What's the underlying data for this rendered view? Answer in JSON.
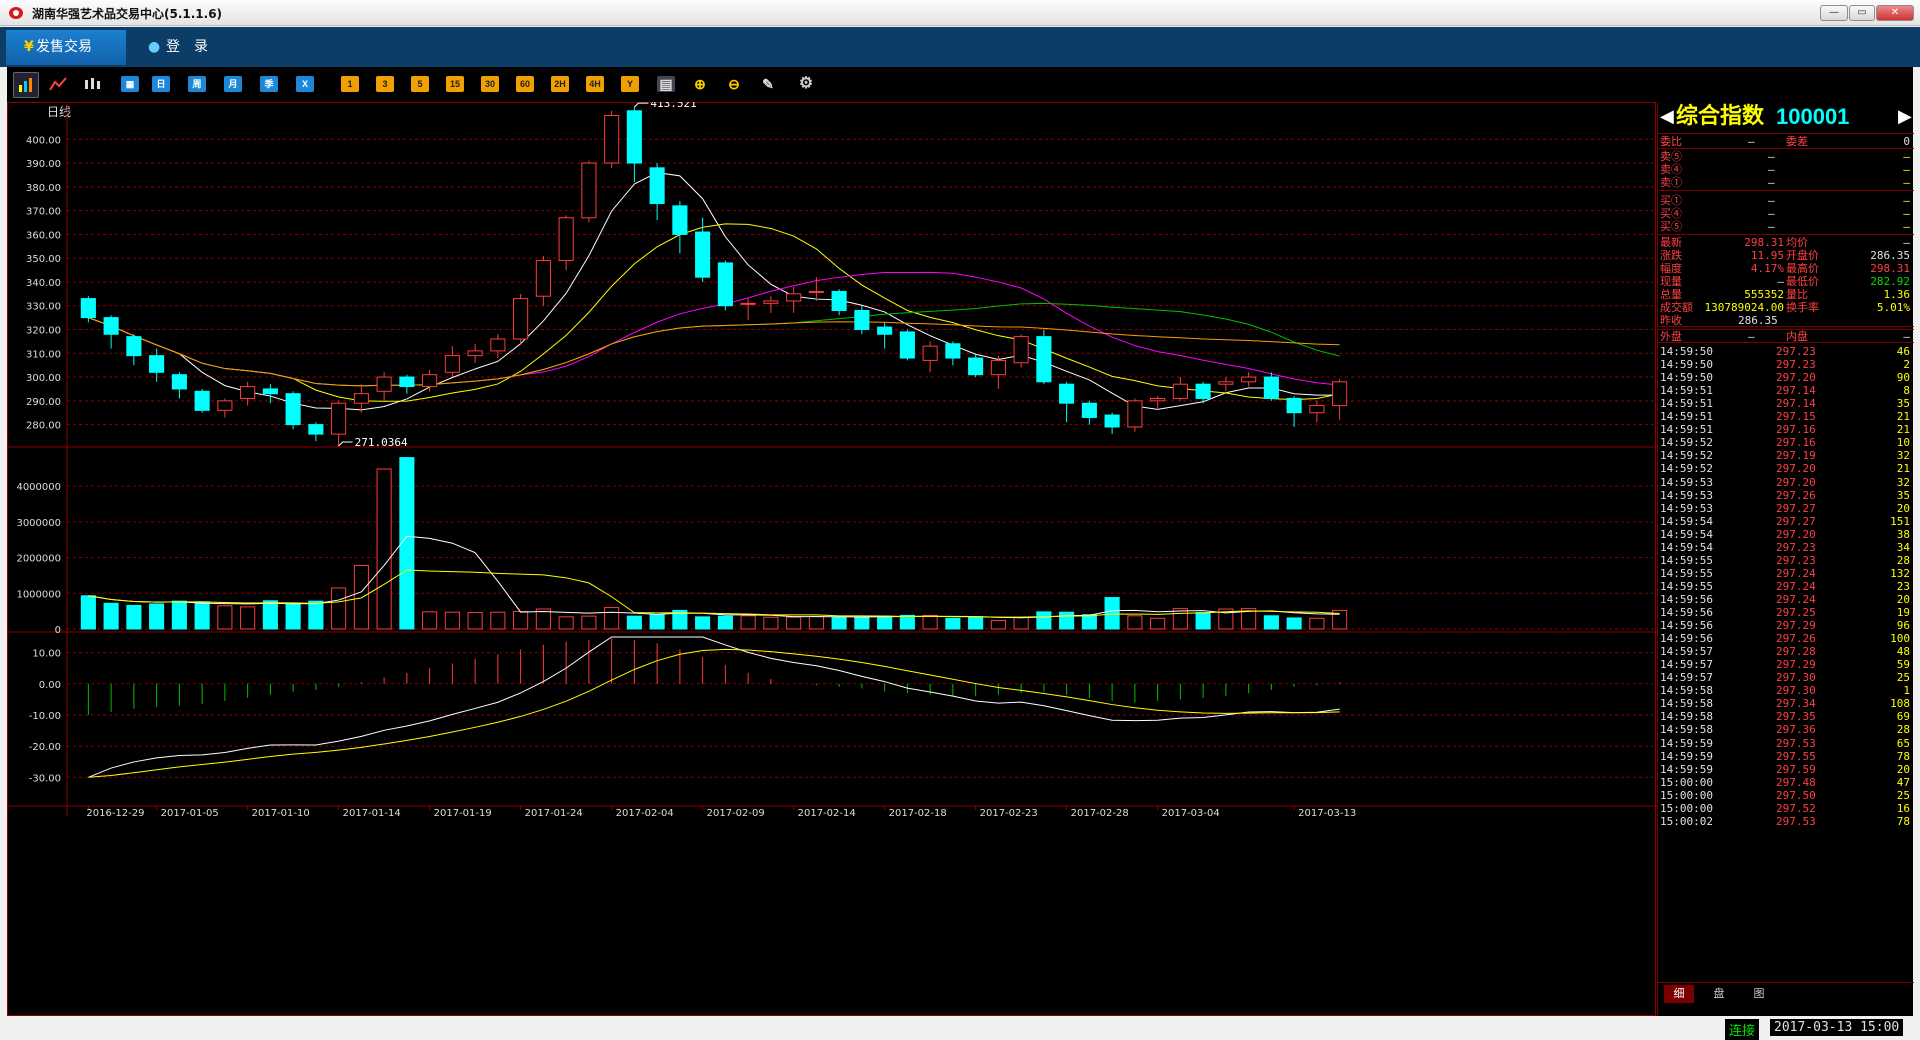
{
  "window": {
    "title": "湖南华强艺术品交易中心(5.1.1.6)",
    "minimize": "—",
    "restore": "▭",
    "close": "✕"
  },
  "menu": {
    "tabs": [
      {
        "label": "发售交易",
        "icon": "yen-icon"
      },
      {
        "label": "登　录",
        "icon": "user-icon"
      }
    ]
  },
  "toolbar": {
    "period_buttons": [
      "日",
      "周",
      "月",
      "季",
      "X"
    ],
    "minute_buttons": [
      "1",
      "3",
      "5",
      "15",
      "30",
      "60",
      "2H",
      "4H",
      "Y"
    ]
  },
  "chart": {
    "period_label": "日线",
    "colors": {
      "up": "#ff3c3c",
      "down": "#00ffff",
      "ma5": "#ffffff",
      "ma10": "#ffff00",
      "ma20": "#ff00ff",
      "ma30": "#00c000",
      "ma60": "#ff9900",
      "grid": "#8b0000"
    },
    "price_ticks": [
      "400.00",
      "390.00",
      "380.00",
      "370.00",
      "360.00",
      "350.00",
      "340.00",
      "330.00",
      "320.00",
      "310.00",
      "300.00",
      "290.00",
      "280.00"
    ],
    "volume_ticks": [
      "4000000",
      "3000000",
      "2000000",
      "1000000",
      "0"
    ],
    "macd_ticks": [
      "10.00",
      "0.00",
      "-10.00",
      "-20.00",
      "-30.00"
    ],
    "date_labels": [
      "2016-12-29",
      "2017-01-05",
      "2017-01-10",
      "2017-01-14",
      "2017-01-19",
      "2017-01-24",
      "2017-02-04",
      "2017-02-09",
      "2017-02-14",
      "2017-02-18",
      "2017-02-23",
      "2017-02-28",
      "2017-03-04",
      "2017-03-13"
    ],
    "high_marker": "413.521",
    "low_marker": "271.0364"
  },
  "chart_data": {
    "type": "candlestick",
    "price_ylim": [
      271,
      414
    ],
    "candles": [
      [
        333,
        325,
        334,
        323
      ],
      [
        325,
        318,
        326,
        312
      ],
      [
        317,
        309,
        318,
        305
      ],
      [
        309,
        302,
        312,
        298
      ],
      [
        301,
        295,
        302,
        291
      ],
      [
        294,
        286,
        295,
        285
      ],
      [
        286,
        290,
        291,
        283
      ],
      [
        291,
        296,
        298,
        288
      ],
      [
        295,
        293,
        297,
        289
      ],
      [
        293,
        280,
        294,
        278
      ],
      [
        280,
        276,
        281,
        273
      ],
      [
        276,
        289,
        290,
        271
      ],
      [
        289,
        293,
        297,
        285
      ],
      [
        294,
        300,
        302,
        290
      ],
      [
        300,
        296,
        301,
        293
      ],
      [
        296,
        301,
        303,
        294
      ],
      [
        302,
        309,
        313,
        300
      ],
      [
        309,
        311,
        314,
        306
      ],
      [
        311,
        316,
        318,
        308
      ],
      [
        316,
        333,
        335,
        314
      ],
      [
        334,
        349,
        351,
        330
      ],
      [
        349,
        367,
        368,
        345
      ],
      [
        367,
        390,
        391,
        365
      ],
      [
        390,
        410,
        412,
        388
      ],
      [
        412,
        390,
        413.521,
        382
      ],
      [
        388,
        373,
        390,
        366
      ],
      [
        372,
        360,
        374,
        352
      ],
      [
        361,
        342,
        367,
        340
      ],
      [
        348,
        330,
        349,
        328
      ],
      [
        331,
        331,
        333,
        324
      ],
      [
        331,
        332,
        334,
        327
      ],
      [
        332,
        335,
        338,
        327
      ],
      [
        336,
        336,
        342,
        332
      ],
      [
        336,
        328,
        337,
        326
      ],
      [
        328,
        320,
        330,
        318
      ],
      [
        321,
        318,
        323,
        312
      ],
      [
        319,
        308,
        320,
        307
      ],
      [
        307,
        313,
        315,
        302
      ],
      [
        314,
        308,
        315,
        305
      ],
      [
        308,
        301,
        310,
        300
      ],
      [
        301,
        307,
        309,
        295
      ],
      [
        306,
        317,
        318,
        304
      ],
      [
        317,
        298,
        320,
        297
      ],
      [
        297,
        289,
        298,
        281
      ],
      [
        289,
        283,
        290,
        280
      ],
      [
        284,
        279,
        285,
        276
      ],
      [
        279,
        290,
        291,
        277
      ],
      [
        290,
        291,
        292,
        287
      ],
      [
        291,
        297,
        300,
        290
      ],
      [
        297,
        291,
        298,
        289
      ],
      [
        297,
        298,
        300,
        294
      ],
      [
        298,
        300,
        302,
        296
      ],
      [
        300,
        291,
        302,
        290
      ],
      [
        291,
        285,
        292,
        279
      ],
      [
        285,
        288,
        290,
        281
      ],
      [
        288,
        298,
        299,
        282
      ]
    ],
    "volumes": [
      930000,
      720000,
      660000,
      700000,
      780000,
      760000,
      650000,
      620000,
      790000,
      710000,
      780000,
      1150000,
      1780000,
      4480000,
      4800000,
      480000,
      470000,
      460000,
      470000,
      490000,
      560000,
      340000,
      360000,
      600000,
      360000,
      390000,
      520000,
      340000,
      360000,
      370000,
      330000,
      330000,
      350000,
      330000,
      340000,
      360000,
      380000,
      380000,
      300000,
      330000,
      240000,
      330000,
      480000,
      470000,
      400000,
      880000,
      370000,
      300000,
      570000,
      460000,
      560000,
      570000,
      370000,
      310000,
      300000,
      520000,
      560000
    ],
    "volume_ylim": [
      0,
      4900000
    ],
    "macd_hist": [
      -10,
      -9,
      -8,
      -7.5,
      -7,
      -6.5,
      -5.5,
      -4.5,
      -3.5,
      -2.5,
      -2,
      -1,
      0.5,
      2,
      3.5,
      5,
      6.5,
      8,
      9.5,
      11,
      12.5,
      13.5,
      14,
      14.5,
      14,
      13,
      11,
      8.5,
      6,
      3.5,
      1.5,
      0,
      -0.5,
      -1,
      -1.5,
      -2.5,
      -3,
      -3.5,
      -4,
      -4,
      -3.5,
      -3,
      -2.5,
      -3.5,
      -4.5,
      -5.5,
      -6,
      -5.5,
      -5,
      -4.5,
      -4,
      -3,
      -2,
      -1,
      -0.5,
      0.5
    ],
    "macd_ylim": [
      -36,
      15
    ]
  },
  "quote": {
    "name": "综合指数",
    "code": "100001",
    "weibi_label": "委比",
    "weibi_value": "—",
    "weicha_label": "委差",
    "weicha_value": "0",
    "sells": [
      {
        "label": "卖⑤",
        "p": "—",
        "v": "—"
      },
      {
        "label": "卖④",
        "p": "—",
        "v": "—"
      },
      {
        "label": "卖①",
        "p": "—",
        "v": "—"
      }
    ],
    "buys": [
      {
        "label": "买①",
        "p": "—",
        "v": "—"
      },
      {
        "label": "买④",
        "p": "—",
        "v": "—"
      },
      {
        "label": "买⑤",
        "p": "—",
        "v": "—"
      }
    ],
    "stats": [
      {
        "l1": "最新",
        "v1": "298.31",
        "l2": "均价",
        "v2": "—"
      },
      {
        "l1": "涨跌",
        "v1": "11.95",
        "l2": "开盘价",
        "v2": "286.35"
      },
      {
        "l1": "幅度",
        "v1": "4.17%",
        "l2": "最高价",
        "v2": "298.31"
      },
      {
        "l1": "现量",
        "v1": "—",
        "l2": "最低价",
        "v2": "282.92"
      },
      {
        "l1": "总量",
        "v1": "555352",
        "l2": "量比",
        "v2": "1.36"
      },
      {
        "l1": "成交额",
        "v1": "130789024.00",
        "l2": "换手率",
        "v2": "5.01%"
      }
    ],
    "prev_close_label": "昨收",
    "prev_close": "286.35",
    "outer_label": "外盘",
    "outer_value": "—",
    "inner_label": "内盘",
    "inner_value": "—"
  },
  "ticks": [
    [
      "14:59:50",
      "297.23",
      "46"
    ],
    [
      "14:59:50",
      "297.23",
      "2"
    ],
    [
      "14:59:50",
      "297.20",
      "90"
    ],
    [
      "14:59:51",
      "297.14",
      "8"
    ],
    [
      "14:59:51",
      "297.14",
      "35"
    ],
    [
      "14:59:51",
      "297.15",
      "21"
    ],
    [
      "14:59:51",
      "297.16",
      "21"
    ],
    [
      "14:59:52",
      "297.16",
      "10"
    ],
    [
      "14:59:52",
      "297.19",
      "32"
    ],
    [
      "14:59:52",
      "297.20",
      "21"
    ],
    [
      "14:59:53",
      "297.20",
      "32"
    ],
    [
      "14:59:53",
      "297.26",
      "35"
    ],
    [
      "14:59:53",
      "297.27",
      "20"
    ],
    [
      "14:59:54",
      "297.27",
      "151"
    ],
    [
      "14:59:54",
      "297.20",
      "38"
    ],
    [
      "14:59:54",
      "297.23",
      "34"
    ],
    [
      "14:59:55",
      "297.23",
      "28"
    ],
    [
      "14:59:55",
      "297.24",
      "132"
    ],
    [
      "14:59:55",
      "297.24",
      "23"
    ],
    [
      "14:59:56",
      "297.24",
      "20"
    ],
    [
      "14:59:56",
      "297.25",
      "19"
    ],
    [
      "14:59:56",
      "297.29",
      "96"
    ],
    [
      "14:59:56",
      "297.26",
      "100"
    ],
    [
      "14:59:57",
      "297.28",
      "48"
    ],
    [
      "14:59:57",
      "297.29",
      "59"
    ],
    [
      "14:59:57",
      "297.30",
      "25"
    ],
    [
      "14:59:58",
      "297.30",
      "1"
    ],
    [
      "14:59:58",
      "297.34",
      "108"
    ],
    [
      "14:59:58",
      "297.35",
      "69"
    ],
    [
      "14:59:58",
      "297.36",
      "28"
    ],
    [
      "14:59:59",
      "297.53",
      "65"
    ],
    [
      "14:59:59",
      "297.55",
      "78"
    ],
    [
      "14:59:59",
      "297.59",
      "20"
    ],
    [
      "15:00:00",
      "297.48",
      "47"
    ],
    [
      "15:00:00",
      "297.50",
      "25"
    ],
    [
      "15:00:00",
      "297.52",
      "16"
    ],
    [
      "15:00:02",
      "297.53",
      "78"
    ]
  ],
  "panel_tabs": [
    "细",
    "盘",
    "图"
  ],
  "status": {
    "connection": "连接",
    "datetime": "2017-03-13 15:00"
  }
}
